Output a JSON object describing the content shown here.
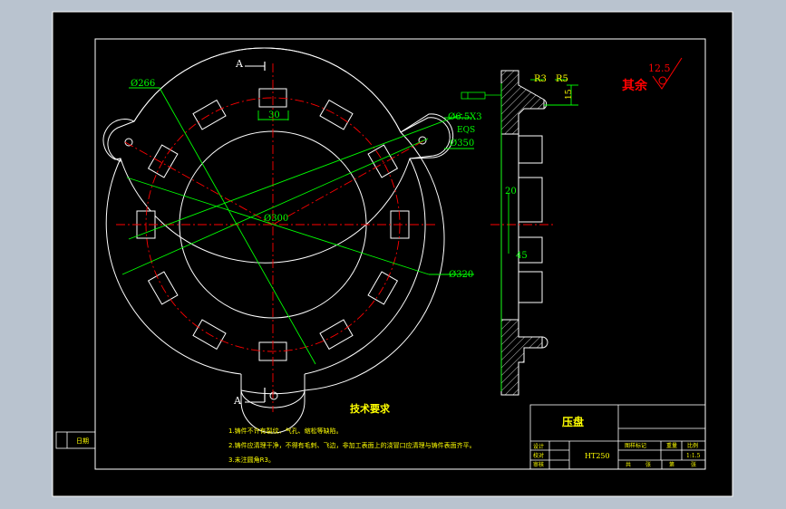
{
  "drawing": {
    "section_label_top": "A",
    "section_label_bottom": "A",
    "dim_d266": "Ø266",
    "dim_d350": "Ø350",
    "dim_d300": "Ø300",
    "dim_d320": "Ø320",
    "dim_30": "30",
    "dim_holes": "Ø6.5X3",
    "dim_eqs": "EQS",
    "dim_r3": "R3",
    "dim_r5": "R5",
    "dim_15": "15",
    "dim_20": "20",
    "dim_45": "45",
    "roughness_value": "12.5",
    "roughness_label": "其余"
  },
  "tech_requirements": {
    "title": "技术要求",
    "items": [
      "1.铸件不许有裂纹、气孔、缩松等缺陷。",
      "2.铸件应清理干净，不得有毛刺、飞边，非加工表面上的浇冒口应清理与铸件表面齐平。",
      "3.未注圆角R3。"
    ]
  },
  "title_block": {
    "part_name": "压盘",
    "material": "HT250",
    "rows_left": [
      "设计",
      "校对",
      "审核"
    ],
    "cols_right": [
      "图样标记",
      "重量",
      "比例"
    ],
    "scale": "1:1.5",
    "bottom_right": [
      "共",
      "张",
      "第",
      "张"
    ]
  },
  "side_stamp": {
    "label": "日期"
  },
  "colors": {
    "background": "#000000",
    "frame": "#ffffff",
    "centerline": "#ff0000",
    "dimension": "#00ff00",
    "text": "#ffff00",
    "roughness": "#ff0000"
  }
}
